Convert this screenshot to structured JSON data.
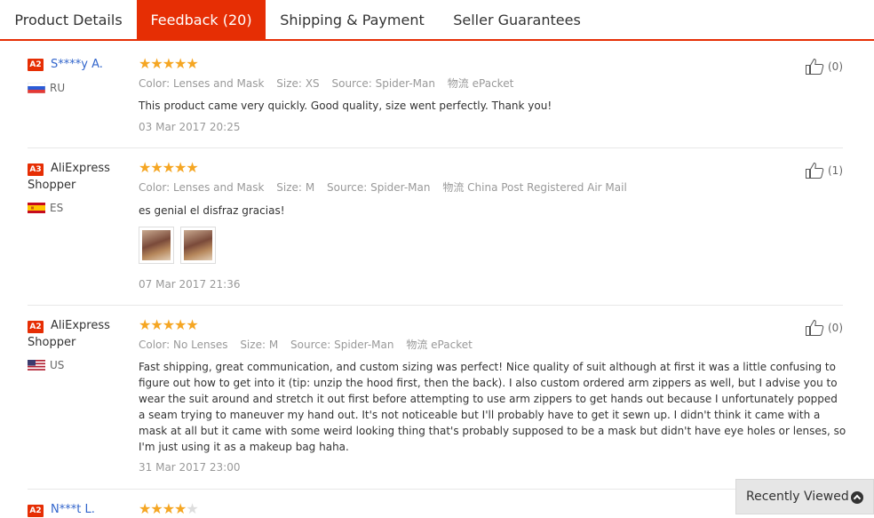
{
  "tabs": [
    "Product Details",
    "Feedback (20)",
    "Shipping & Payment",
    "Seller Guarantees"
  ],
  "labels": {
    "color": "Color:",
    "size": "Size:",
    "source": "Source:",
    "logistics": "物流"
  },
  "reviews": [
    {
      "badge": "A2",
      "name": "S****y A.",
      "name2": "",
      "country": "RU",
      "stars": "★★★★★",
      "stars_off": "",
      "color": "Lenses and Mask",
      "size": "XS",
      "source": "Spider-Man",
      "shipping": "ePacket",
      "text": "This product came very quickly. Good quality, size went perfectly. Thank you!",
      "date": "03 Mar 2017 20:25",
      "helpful": "(0)"
    },
    {
      "badge": "A3",
      "name": "AliExpress",
      "name2": "Shopper",
      "country": "ES",
      "stars": "★★★★★",
      "stars_off": "",
      "color": "Lenses and Mask",
      "size": "M",
      "source": "Spider-Man",
      "shipping": "China Post Registered Air Mail",
      "text": "es genial el disfraz gracias!",
      "date": "07 Mar 2017 21:36",
      "helpful": "(1)"
    },
    {
      "badge": "A2",
      "name": "AliExpress",
      "name2": "Shopper",
      "country": "US",
      "stars": "★★★★★",
      "stars_off": "",
      "color": "No Lenses",
      "size": "M",
      "source": "Spider-Man",
      "shipping": "ePacket",
      "text": "Fast shipping, great communication, and custom sizing was perfect! Nice quality of suit although at first it was a little confusing to figure out how to get into it (tip: unzip the hood first, then the back). I also custom ordered arm zippers as well, but I advise you to wear the suit around and stretch it out first before attempting to use arm zippers to get hands out because I unfortunately popped a seam trying to maneuver my hand out. It's not noticeable but I'll probably have to get it sewn up. I didn't think it came with a mask at all but it came with some weird looking thing that's probably supposed to be a mask but didn't have eye holes or lenses, so I'm just using it as a makeup bag haha.",
      "date": "31 Mar 2017 23:00",
      "helpful": "(0)"
    },
    {
      "badge": "A2",
      "name": "N***t L.",
      "name2": "",
      "country": "",
      "stars": "★★★★",
      "stars_off": "★"
    }
  ],
  "recently_viewed": "Recently Viewed",
  "colors": {
    "accent": "#e62e04",
    "star": "#f5a623",
    "link": "#3366cc"
  }
}
